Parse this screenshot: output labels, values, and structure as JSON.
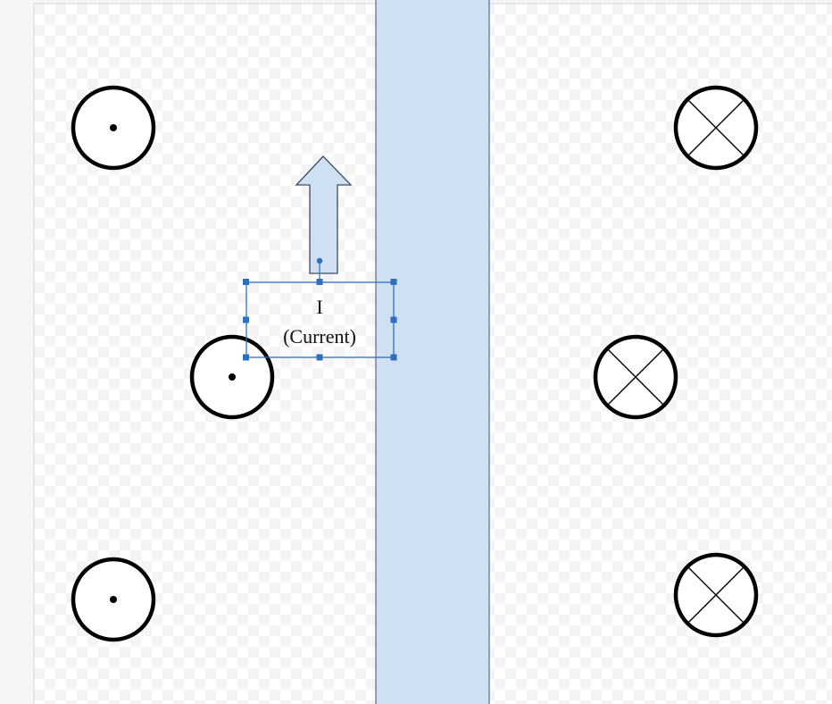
{
  "label": {
    "line1": "I",
    "line2": "(Current)"
  },
  "symbols": {
    "dot": "out-of-page-dot-symbol",
    "cross": "into-page-cross-symbol"
  },
  "colors": {
    "page_background": "#ffffff",
    "checker": "#f3f3f3",
    "canvas_outer": "#f5f6f8",
    "conductor_fill": "#cfe0f2",
    "conductor_stroke": "#5a6e85",
    "arrow_fill": "#cfe0f2",
    "arrow_stroke": "#3b4d63",
    "selection": "#2f6fbf",
    "symbol_stroke": "#000000"
  }
}
